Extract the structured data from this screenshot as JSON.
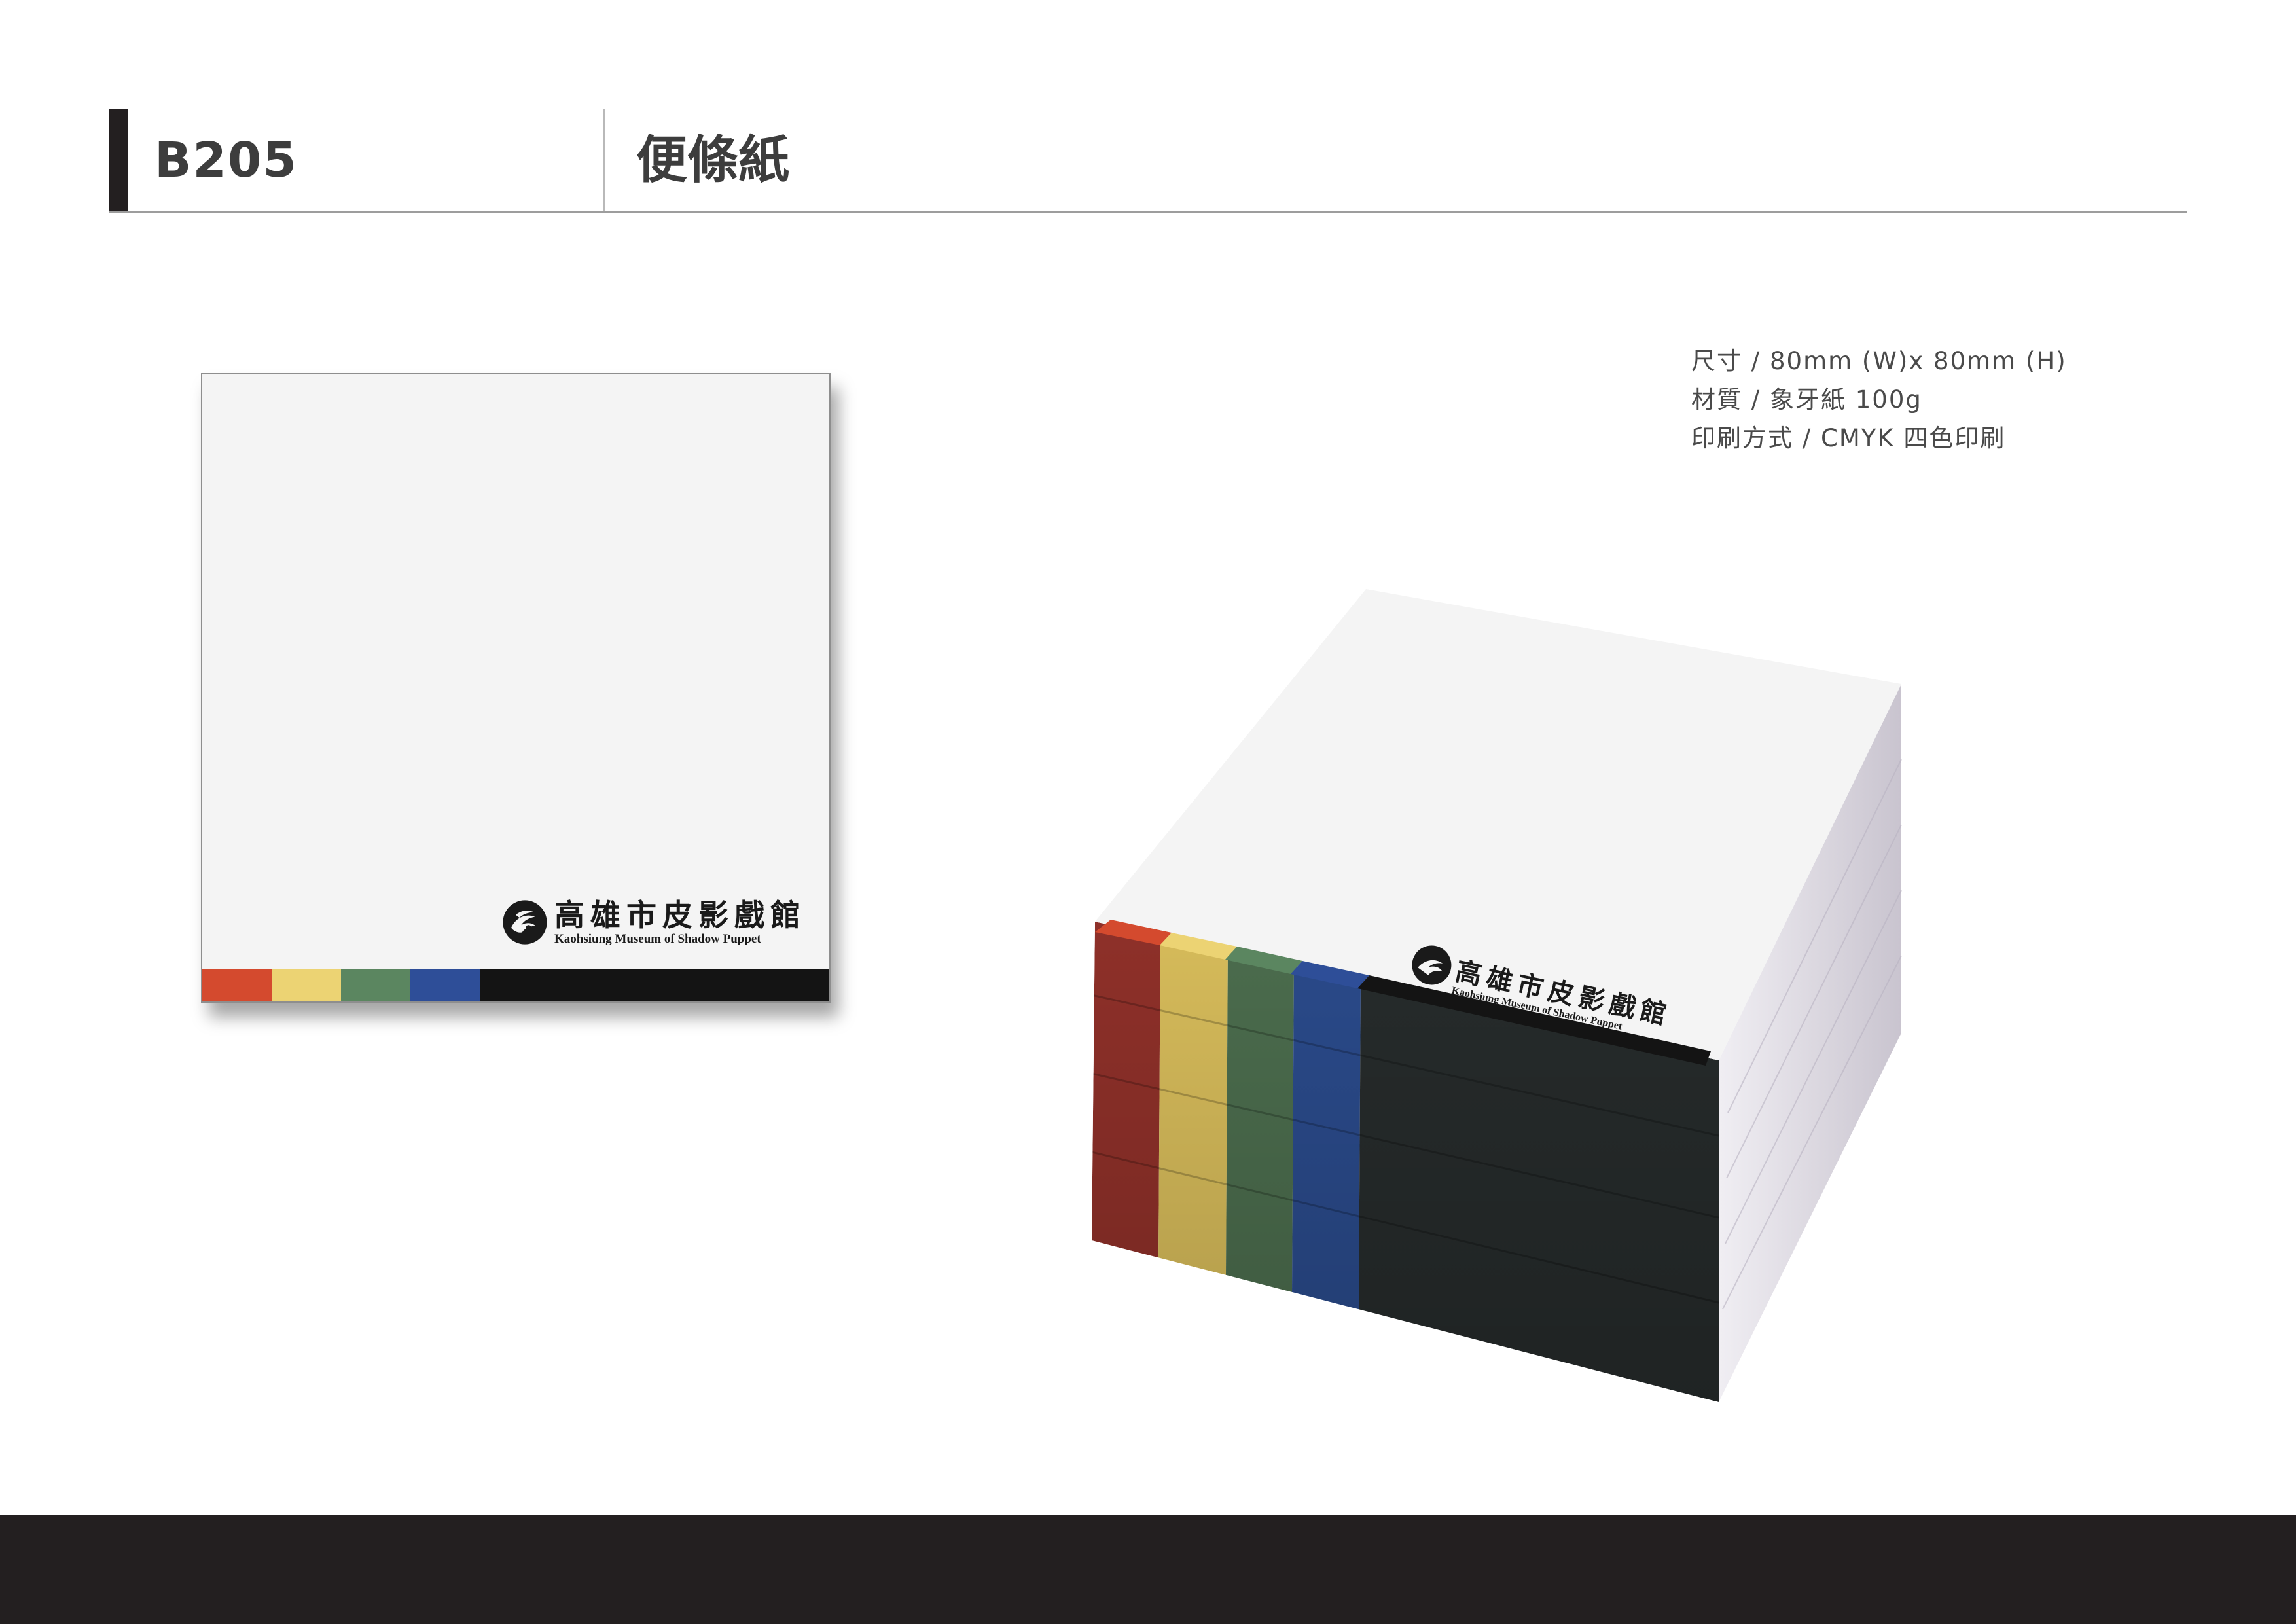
{
  "header": {
    "code": "B205",
    "name": "便條紙"
  },
  "specs": [
    "尺寸 / 80mm (W)x 80mm (H)",
    "材質 / 象牙紙 100g",
    "印刷方式 / CMYK 四色印刷"
  ],
  "logo": {
    "name_zh": "高雄市皮影戲館",
    "name_en": "Kaohsiung Museum of Shadow Puppet",
    "emblem": "shadow-puppet-emblem-icon"
  },
  "colors": {
    "red": "#d44a2e",
    "yellow": "#ecd373",
    "green": "#5b8660",
    "blue": "#2e4e98",
    "black": "#141414",
    "footer": "#231f20"
  }
}
